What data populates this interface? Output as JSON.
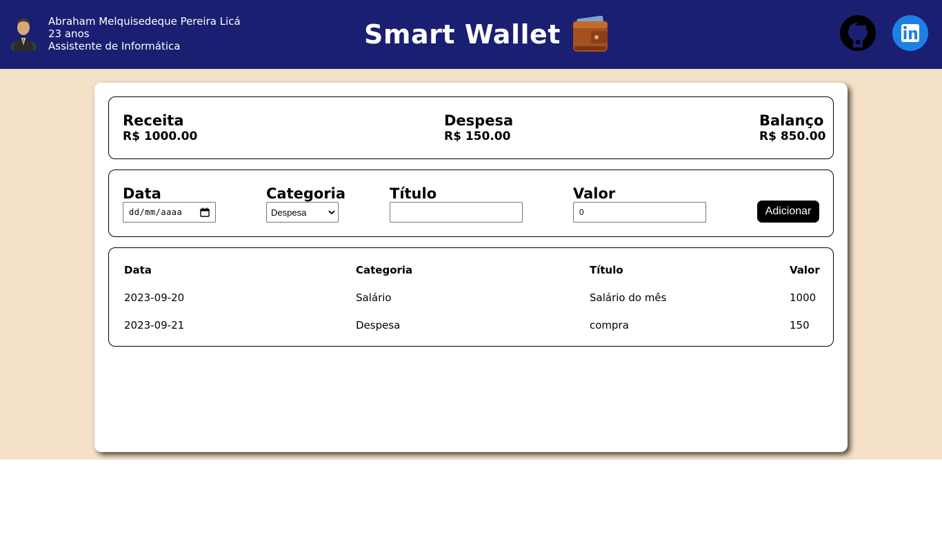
{
  "user": {
    "name": "Abraham Melquisedeque Pereira Licá",
    "age": "23 anos",
    "role": "Assistente de Informática"
  },
  "brand": {
    "title": "Smart Wallet"
  },
  "social": {
    "github_icon": "github-icon",
    "linkedin_icon": "linkedin-icon"
  },
  "colors": {
    "header": "#1a1f71",
    "page_bg": "#f5e1c8",
    "linkedin": "#1d80e4"
  },
  "summary": {
    "receita": {
      "label": "Receita",
      "value": "R$ 1000.00"
    },
    "despesa": {
      "label": "Despesa",
      "value": "R$ 150.00"
    },
    "balanco": {
      "label": "Balanço",
      "value": "R$ 850.00"
    }
  },
  "form": {
    "data": {
      "label": "Data",
      "placeholder": "dd/mm/aaaa"
    },
    "categoria": {
      "label": "Categoria",
      "selected": "Despesa"
    },
    "titulo": {
      "label": "Título",
      "value": ""
    },
    "valor": {
      "label": "Valor",
      "value": "0"
    },
    "add_label": "Adicionar"
  },
  "table": {
    "headers": [
      "Data",
      "Categoria",
      "Título",
      "Valor"
    ],
    "rows": [
      [
        "2023-09-20",
        "Salário",
        "Salário do mês",
        "1000"
      ],
      [
        "2023-09-21",
        "Despesa",
        "compra",
        "150"
      ]
    ]
  }
}
